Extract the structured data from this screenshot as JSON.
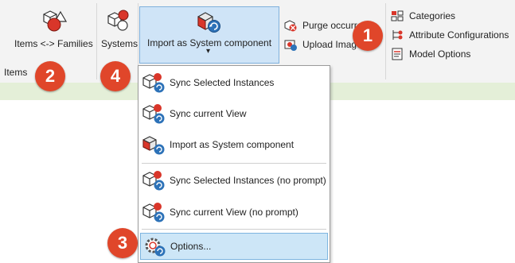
{
  "ribbon": {
    "items_families_label": "Items <-> Families",
    "systems_label": "Systems",
    "import_label": "Import as System component",
    "dropdown_arrow": "▾",
    "panel_label": "Items",
    "purge_label": "Purge occurre",
    "upload_label": "Upload Image",
    "categories_label": "Categories",
    "attribute_label": "Attribute Configurations",
    "model_options_label": "Model Options"
  },
  "menu": {
    "items": [
      {
        "label": "Sync Selected Instances",
        "icon": "sync-selected-instances-icon"
      },
      {
        "label": "Sync current View",
        "icon": "sync-current-view-icon"
      },
      {
        "label": "Import as System component",
        "icon": "import-system-component-icon"
      },
      {
        "label": "Sync Selected Instances (no prompt)",
        "icon": "sync-selected-instances-icon"
      },
      {
        "label": "Sync current View (no prompt)",
        "icon": "sync-current-view-icon"
      },
      {
        "label": "Options...",
        "icon": "options-gear-icon"
      }
    ]
  },
  "badges": [
    "1",
    "2",
    "3",
    "4"
  ],
  "colors": {
    "badge": "#e0462a",
    "ribbon": "#f3f3f3",
    "strip": "#e4efd8",
    "highlight": "#cde6f7",
    "accent_red": "#d9362a",
    "accent_blue": "#2d72b8"
  }
}
